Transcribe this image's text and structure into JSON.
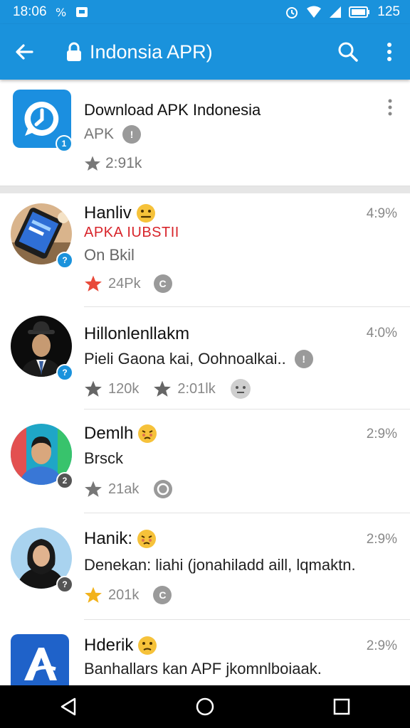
{
  "status_bar": {
    "time": "18:06",
    "battery": "125"
  },
  "app_bar": {
    "title": "Indonsia APR)"
  },
  "featured": {
    "title": "Download APK Indonesia",
    "subtitle": "APK",
    "rating": "2:91k",
    "badge": "1"
  },
  "items": [
    {
      "name": "Hanliv",
      "time": "4:9%",
      "line1": "APKA IUBSTII",
      "line2": "On Bkil",
      "rating": "24Pk",
      "badge": "?"
    },
    {
      "name": "Hillonlenllakm",
      "time": "4:0%",
      "line1": "Pieli Gaona kai, Oohnoalkai..",
      "rating": "120k",
      "rating2": "2:01lk",
      "badge": "?"
    },
    {
      "name": "Demlh",
      "time": "2:9%",
      "line1": "Brsck",
      "rating": "21ak",
      "badge": "2"
    },
    {
      "name": "Hanik:",
      "time": "2:9%",
      "line1": "Denekan: liahi (jonahiladd aill, lqmaktn.",
      "rating": "201k",
      "badge": "?"
    },
    {
      "name": "Hderik",
      "time": "2:9%",
      "line1": "Banhallars kan APF jkomnlboiaak."
    }
  ],
  "colors": {
    "primary": "#1a92dc",
    "accent_red": "#d8252b",
    "star_gold": "#f2b21b",
    "star_red": "#e84a3a"
  },
  "icons": [
    "back-arrow-icon",
    "lock-icon",
    "search-icon",
    "more-vert-icon",
    "star-icon",
    "info-icon",
    "nav-back-icon",
    "nav-home-icon",
    "nav-recents-icon"
  ]
}
